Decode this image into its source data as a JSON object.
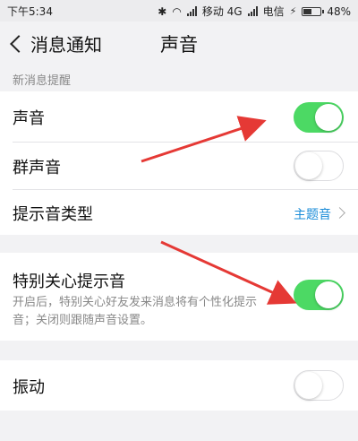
{
  "status_bar": {
    "time": "下午5:34",
    "carrier1": "移动 4G",
    "carrier2": "电信",
    "battery": "48%"
  },
  "header": {
    "back_label": "消息通知",
    "title": "声音"
  },
  "section1": {
    "header": "新消息提醒",
    "rows": [
      {
        "label": "声音",
        "toggle": "on"
      },
      {
        "label": "群声音",
        "toggle": "off"
      },
      {
        "label": "提示音类型",
        "value": "主题音"
      }
    ]
  },
  "section2": {
    "label": "特别关心提示音",
    "toggle": "on",
    "description": "开启后，特别关心好友发来消息将有个性化提示音；关闭则跟随声音设置。"
  },
  "section3": {
    "label": "振动",
    "toggle": "off"
  },
  "colors": {
    "toggle_on": "#4cd964",
    "link": "#1a8cd8",
    "annotation_arrow": "#e53935"
  }
}
